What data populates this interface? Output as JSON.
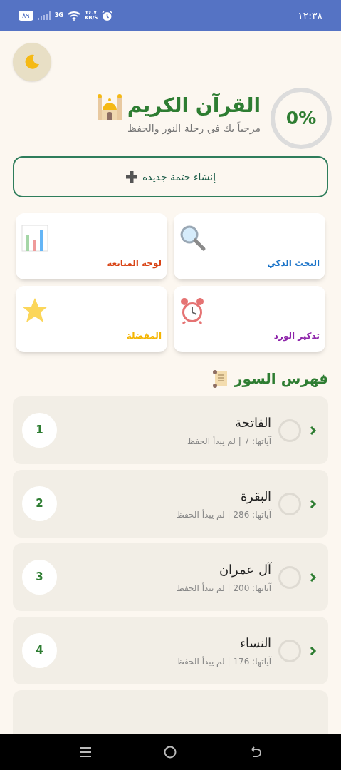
{
  "status_bar": {
    "time": "١٢:٣٨",
    "battery": "٨٩",
    "network": "3G",
    "speed": "٢٤.٧",
    "speed_unit": "KB/S"
  },
  "header": {
    "title": "القرآن الكريم",
    "subtitle": "مرحباً بك في رحلة النور والحفظ",
    "progress": {
      "label": "0%"
    }
  },
  "new_khatma_button": "إنشاء ختمة جديدة",
  "features": [
    {
      "label": "البحث الذكي",
      "kind": "search",
      "color": "#1a73c8"
    },
    {
      "label": "لوحة المتابعة",
      "kind": "chart",
      "color": "#d84315"
    },
    {
      "label": "تذكير الورد",
      "kind": "alarm",
      "color": "#8e24aa"
    },
    {
      "label": "المفضلة",
      "kind": "star",
      "color": "#f4b400"
    }
  ],
  "surah_index": {
    "title": "فهرس السور",
    "items": [
      {
        "number": "1",
        "name": "الفاتحة",
        "info": "آياتها: 7 | لم يبدأ الحفظ",
        "checked": false
      },
      {
        "number": "2",
        "name": "البقرة",
        "info": "آياتها: 286 | لم يبدأ الحفظ",
        "checked": false
      },
      {
        "number": "3",
        "name": "آل عمران",
        "info": "آياتها: 200 | لم يبدأ الحفظ",
        "checked": false
      },
      {
        "number": "4",
        "name": "النساء",
        "info": "آياتها: 176 | لم يبدأ الحفظ",
        "checked": false
      }
    ]
  }
}
